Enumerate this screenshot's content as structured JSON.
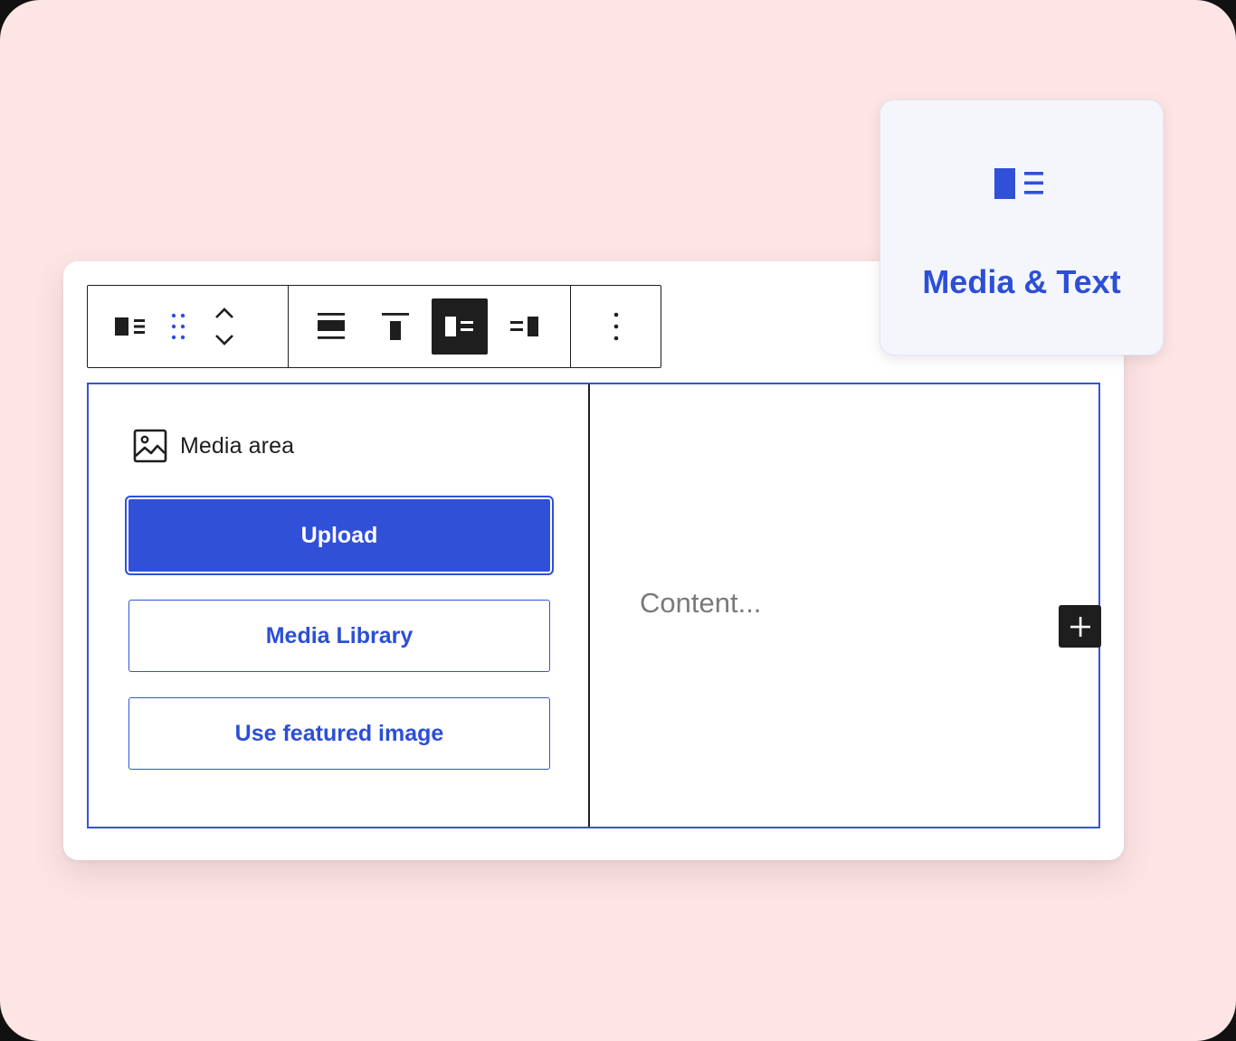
{
  "colors": {
    "background": "#fde5e5",
    "accent": "#3150d8",
    "toolbar_dark": "#1e1e1e",
    "placeholder_text": "#7a7a7a"
  },
  "block_card": {
    "icon": "media-text-icon",
    "title": "Media & Text"
  },
  "toolbar": {
    "groups": [
      {
        "items": [
          "media-text-block-icon",
          "drag-handle-icon",
          "move-up-icon",
          "move-down-icon"
        ]
      },
      {
        "items": [
          "align-wide-icon",
          "vertical-align-top-icon",
          "media-left-icon",
          "media-right-icon"
        ],
        "active": "media-left-icon"
      },
      {
        "items": [
          "more-options-icon"
        ]
      }
    ]
  },
  "media_area": {
    "icon": "image-icon",
    "label": "Media area",
    "buttons": {
      "upload": "Upload",
      "media_library": "Media Library",
      "featured_image": "Use featured image"
    }
  },
  "content": {
    "placeholder": "Content..."
  },
  "inserter": {
    "icon": "plus-icon"
  }
}
